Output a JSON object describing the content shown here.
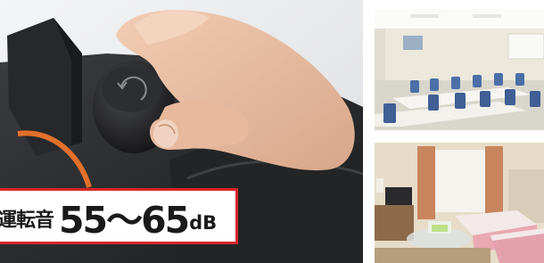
{
  "noise_label": {
    "prefix": "運転音",
    "value": "55～65",
    "unit": "dB"
  },
  "colors": {
    "label_border": "#d8262b",
    "machine_body": "#2a2b2d",
    "accent_orange": "#e2702b"
  }
}
